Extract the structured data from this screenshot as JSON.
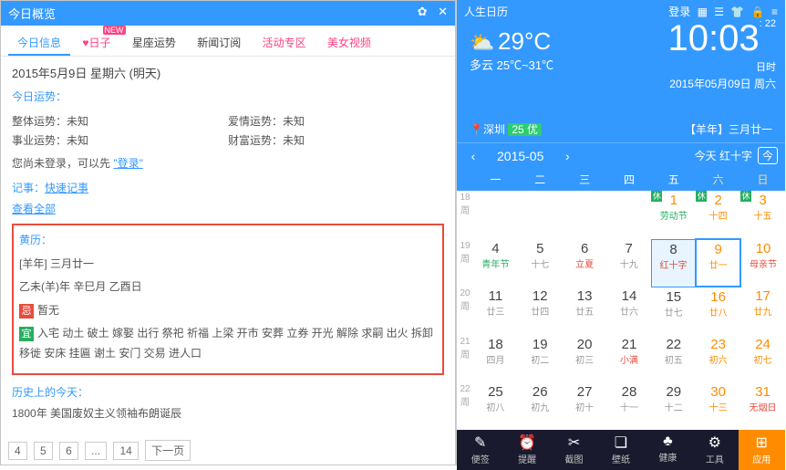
{
  "left": {
    "title": "今日概览",
    "tabs": [
      "今日信息",
      "日子",
      "星座运势",
      "新闻订阅",
      "活动专区",
      "美女视频"
    ],
    "new_badge": "NEW",
    "date": "2015年5月9日 星期六 (明天)",
    "fortune_title": "今日运势：",
    "fortune": [
      {
        "k": "整体运势：",
        "v": "未知"
      },
      {
        "k": "爱情运势：",
        "v": "未知"
      },
      {
        "k": "事业运势：",
        "v": "未知"
      },
      {
        "k": "财富运势：",
        "v": "未知"
      }
    ],
    "login_pre": "您尚未登录，可以先",
    "login_link": "\"登录\"",
    "note_title": "记事：",
    "note_link": "快速记事",
    "view_all": "查看全部",
    "almanac_title": "黄历：",
    "almanac_year": "[羊年] 三月廿一",
    "almanac_gz": "乙未(羊)年 辛巳月 乙酉日",
    "ji_label": "忌",
    "ji_text": "暂无",
    "yi_label": "宜",
    "yi_text": "入宅 动土 破土 嫁娶 出行 祭祀 祈福 上梁 开市 安葬 立券 开光 解除 求嗣 出火 拆卸 移徙 安床 挂匾 谢土 安门 交易 进人口",
    "history_title": "历史上的今天：",
    "history_item": "1800年 美国废奴主义领袖布朗诞辰",
    "pager": [
      "4",
      "5",
      "6",
      "...",
      "14",
      "下一页"
    ]
  },
  "right": {
    "title": "人生日历",
    "top_login": "登录",
    "weather_desc": "多云 25℃~31℃",
    "weather_temp": "29°C",
    "clock": "10:03",
    "clock_sec": ": 22",
    "clock_unit": "日时",
    "date": "2015年05月09日 周六",
    "loc_city": "深圳",
    "loc_air_n": "25",
    "loc_air_t": "优",
    "nian": "【羊年】三月廿一",
    "month": "2015-05",
    "today_text": "今天 红十字",
    "today_btn": "今",
    "wd": [
      "一",
      "二",
      "三",
      "四",
      "五",
      "六",
      "日"
    ],
    "weeks": [
      {
        "wk": "18",
        "days": [
          {},
          {},
          {},
          {},
          {
            "n": "1",
            "sub": "劳动节",
            "fes": 1,
            "xiu": 1,
            "we": 1
          },
          {
            "n": "2",
            "sub": "十四",
            "xiu": 1,
            "we": 1
          },
          {
            "n": "3",
            "sub": "十五",
            "xiu": 1,
            "we": 1
          }
        ]
      },
      {
        "wk": "19",
        "days": [
          {
            "n": "4",
            "sub": "青年节",
            "fes": 1
          },
          {
            "n": "5",
            "sub": "十七"
          },
          {
            "n": "6",
            "sub": "立夏",
            "fesr": 1
          },
          {
            "n": "7",
            "sub": "十九"
          },
          {
            "n": "8",
            "sub": "红十字",
            "fesr": 1,
            "hl": 1
          },
          {
            "n": "9",
            "sub": "廿一",
            "we": 1,
            "sel": 1
          },
          {
            "n": "10",
            "sub": "母亲节",
            "fesr": 1,
            "we": 1
          }
        ]
      },
      {
        "wk": "20",
        "days": [
          {
            "n": "11",
            "sub": "廿三"
          },
          {
            "n": "12",
            "sub": "廿四"
          },
          {
            "n": "13",
            "sub": "廿五"
          },
          {
            "n": "14",
            "sub": "廿六"
          },
          {
            "n": "15",
            "sub": "廿七"
          },
          {
            "n": "16",
            "sub": "廿八",
            "we": 1
          },
          {
            "n": "17",
            "sub": "廿九",
            "we": 1
          }
        ]
      },
      {
        "wk": "21",
        "days": [
          {
            "n": "18",
            "sub": "四月"
          },
          {
            "n": "19",
            "sub": "初二"
          },
          {
            "n": "20",
            "sub": "初三"
          },
          {
            "n": "21",
            "sub": "小满",
            "fesr": 1
          },
          {
            "n": "22",
            "sub": "初五"
          },
          {
            "n": "23",
            "sub": "初六",
            "we": 1
          },
          {
            "n": "24",
            "sub": "初七",
            "we": 1
          }
        ]
      },
      {
        "wk": "22",
        "days": [
          {
            "n": "25",
            "sub": "初八"
          },
          {
            "n": "26",
            "sub": "初九"
          },
          {
            "n": "27",
            "sub": "初十"
          },
          {
            "n": "28",
            "sub": "十一"
          },
          {
            "n": "29",
            "sub": "十二"
          },
          {
            "n": "30",
            "sub": "十三",
            "we": 1
          },
          {
            "n": "31",
            "sub": "无烟日",
            "fesr": 1,
            "we": 1
          }
        ]
      }
    ],
    "bbar": [
      {
        "ic": "✎",
        "t": "便签"
      },
      {
        "ic": "⏰",
        "t": "提醒"
      },
      {
        "ic": "✂",
        "t": "截图"
      },
      {
        "ic": "❏",
        "t": "壁纸"
      },
      {
        "ic": "♣",
        "t": "健康"
      },
      {
        "ic": "⚙",
        "t": "工具"
      },
      {
        "ic": "⊞",
        "t": "应用",
        "app": 1
      }
    ]
  }
}
